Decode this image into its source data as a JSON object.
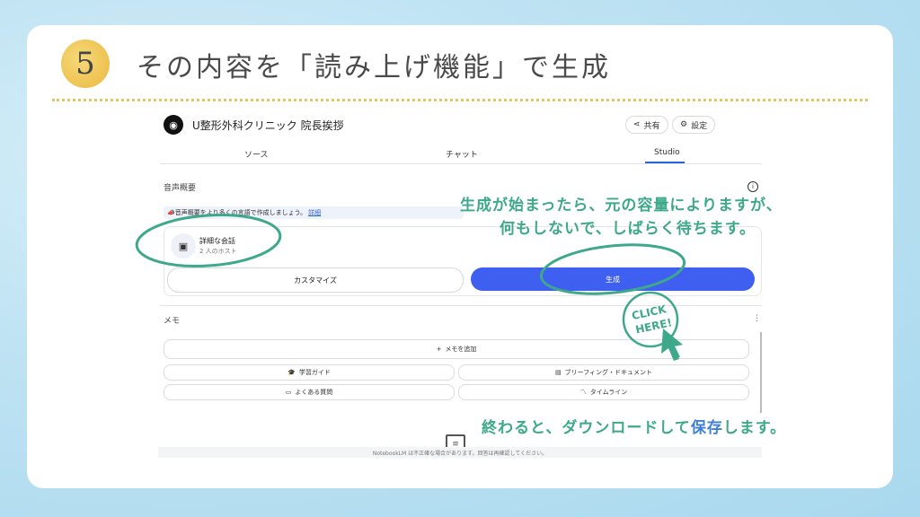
{
  "slide": {
    "step_number": "5",
    "title": "その内容を「読み上げ機能」で生成"
  },
  "notebook": {
    "title": "U整形外科クリニック 院長挨拶",
    "share_label": "共有",
    "settings_label": "設定",
    "tabs": [
      "ソース",
      "チャット",
      "Studio"
    ],
    "active_tab": "Studio"
  },
  "audio_overview": {
    "heading": "音声概要",
    "notice_text": "音声概要をより多くの言語で作成しましょう。",
    "notice_link": "詳細",
    "conversation_title": "詳細な会話",
    "conversation_subtitle": "2 人のホスト",
    "customize_label": "カスタマイズ",
    "generate_label": "生成"
  },
  "notes": {
    "heading": "メモ",
    "add_note_label": "メモを追加",
    "buttons": [
      "学習ガイド",
      "ブリーフィング・ドキュメント",
      "よくある質問",
      "タイムライン"
    ]
  },
  "footer": {
    "disclaimer": "NotebookLM は不正確な場合があります。回答は再確認してください。"
  },
  "annotations": {
    "line1": "生成が始まったら、元の容量によりますが、",
    "line2": "何もしないで、しばらく待ちます。",
    "bottom_prefix": "終わると、ダウンロードして",
    "bottom_highlight": "保存",
    "bottom_suffix": "します。",
    "click_text_1": "CLICK",
    "click_text_2": "HERE!"
  },
  "colors": {
    "accent_green": "#3ea98a",
    "accent_blue": "#3f5ff0",
    "badge_yellow": "#efc556"
  }
}
